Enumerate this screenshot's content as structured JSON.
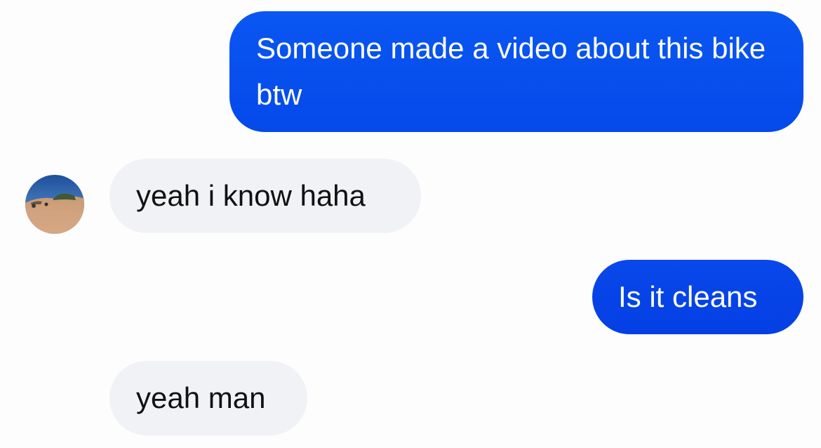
{
  "conversation": {
    "messages": [
      {
        "direction": "outgoing",
        "text": "Someone made a video about this bike btw"
      },
      {
        "direction": "incoming",
        "text": "yeah i know haha"
      },
      {
        "direction": "outgoing",
        "text": "Is it cleans"
      },
      {
        "direction": "incoming",
        "text": "yeah man"
      }
    ]
  },
  "contact": {
    "avatar_icon": "user-avatar-desert-photo"
  },
  "colors": {
    "outgoing_bubble": "#0650ee",
    "incoming_bubble": "#f1f2f6",
    "background": "#fdfdfe"
  }
}
